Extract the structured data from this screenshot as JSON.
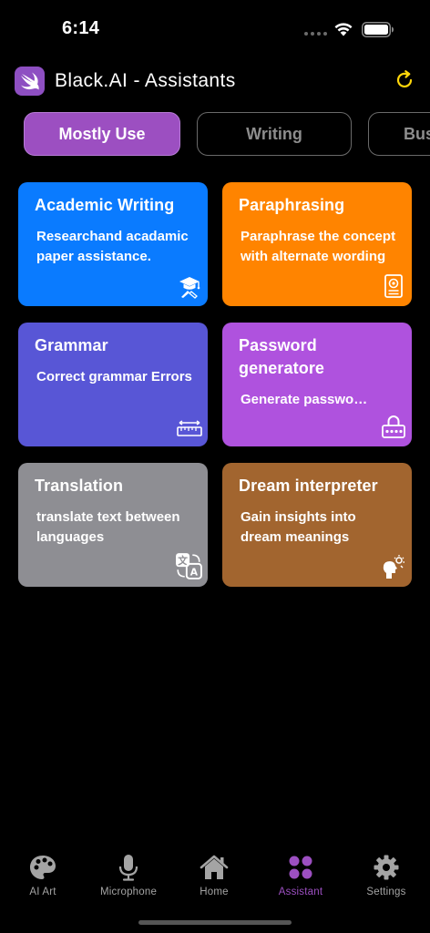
{
  "status_bar": {
    "time": "6:14"
  },
  "header": {
    "title": "Black.AI - Assistants"
  },
  "chips": [
    {
      "label": "Mostly Use"
    },
    {
      "label": "Writing"
    },
    {
      "label": "Bus"
    }
  ],
  "cards": [
    {
      "title": "Academic Writing",
      "desc": "Researchand acadamic paper assistance.",
      "color": "#0a7bff",
      "icon": "graduation-cap-icon"
    },
    {
      "title": "Paraphrasing",
      "desc": "Paraphrase the concept with alternate wording",
      "color": "#ff8400",
      "icon": "document-icon"
    },
    {
      "title": "Grammar",
      "desc": "Correct grammar Errors",
      "color": "#5856d6",
      "icon": "ruler-icon"
    },
    {
      "title": "Password generatore",
      "desc": "Generate password for ap...",
      "color": "#af52de",
      "icon": "lock-icon"
    },
    {
      "title": "Translation",
      "desc": "translate text between languages",
      "color": "#8e8e93",
      "icon": "translate-icon"
    },
    {
      "title": "Dream interpreter",
      "desc": "Gain insights into dream meanings",
      "color": "#a2652f",
      "icon": "brain-idea-icon"
    }
  ],
  "tabs": [
    {
      "label": "AI Art",
      "icon": "palette-icon"
    },
    {
      "label": "Microphone",
      "icon": "microphone-icon"
    },
    {
      "label": "Home",
      "icon": "house-icon"
    },
    {
      "label": "Assistant",
      "icon": "four-dots-icon",
      "active": true
    },
    {
      "label": "Settings",
      "icon": "gear-icon"
    }
  ],
  "colors": {
    "accent": "#9c4fc1",
    "refresh": "#ffd60a",
    "tab_inactive": "#a4a4a4"
  }
}
